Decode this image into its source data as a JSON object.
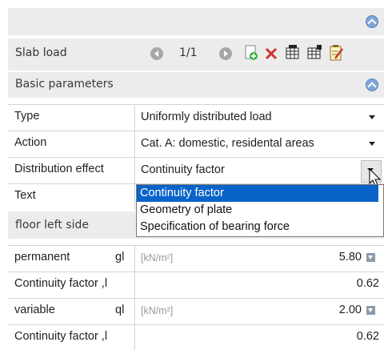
{
  "header": {
    "collapse_icon": "chevron-up-circle-icon"
  },
  "slab_load": {
    "label": "Slab load",
    "pager": "1/1",
    "toolbar_icons": [
      "prev-icon",
      "next-icon",
      "add-icon",
      "delete-icon",
      "table-insert-icon",
      "table-append-icon",
      "edit-notes-icon"
    ]
  },
  "basic_parameters": {
    "title": "Basic parameters"
  },
  "rows": [
    {
      "label": "Type",
      "value": "Uniformly distributed load"
    },
    {
      "label": "Action",
      "value": "Cat. A: domestic, residental areas"
    },
    {
      "label": "Distribution effect",
      "value": "Continuity factor"
    },
    {
      "label": "Text",
      "value": ""
    }
  ],
  "dropdown": {
    "options": [
      "Continuity factor",
      "Geometry of plate",
      "Specification of bearing force"
    ],
    "selected_index": 0
  },
  "floor_left_side": {
    "title": "floor left side"
  },
  "floor_rows": [
    {
      "label": "permanent",
      "symbol": "gl",
      "unit": "[kN/m²]",
      "value": "5.80"
    },
    {
      "label": "Continuity factor ,l",
      "symbol": "",
      "unit": "",
      "value": "0.62"
    },
    {
      "label": "variable",
      "symbol": "ql",
      "unit": "[kN/m²]",
      "value": "2.00"
    },
    {
      "label": "Continuity factor ,l",
      "symbol": "",
      "unit": "",
      "value": "0.62"
    }
  ],
  "colors": {
    "band": "#ececec",
    "selection": "#0a63c9",
    "accent": "#7fa6d8"
  }
}
